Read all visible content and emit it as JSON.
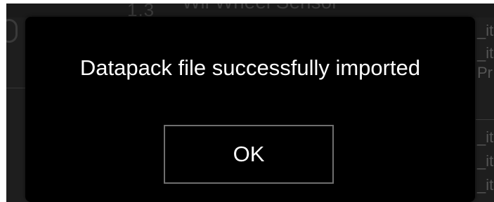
{
  "background": {
    "version_text": "1.3",
    "title_text": "Wii Wheel Sensor",
    "right_column_text": [
      "_it",
      "_it",
      "Pr",
      "_it",
      "_it",
      "_it"
    ]
  },
  "dialog": {
    "message": "Datapack file successfully imported",
    "ok_label": "OK"
  },
  "colors": {
    "dialog_background": "#000000",
    "dialog_text": "#ffffff",
    "button_border": "#6e6e6e",
    "app_background": "#1e1e1e"
  }
}
